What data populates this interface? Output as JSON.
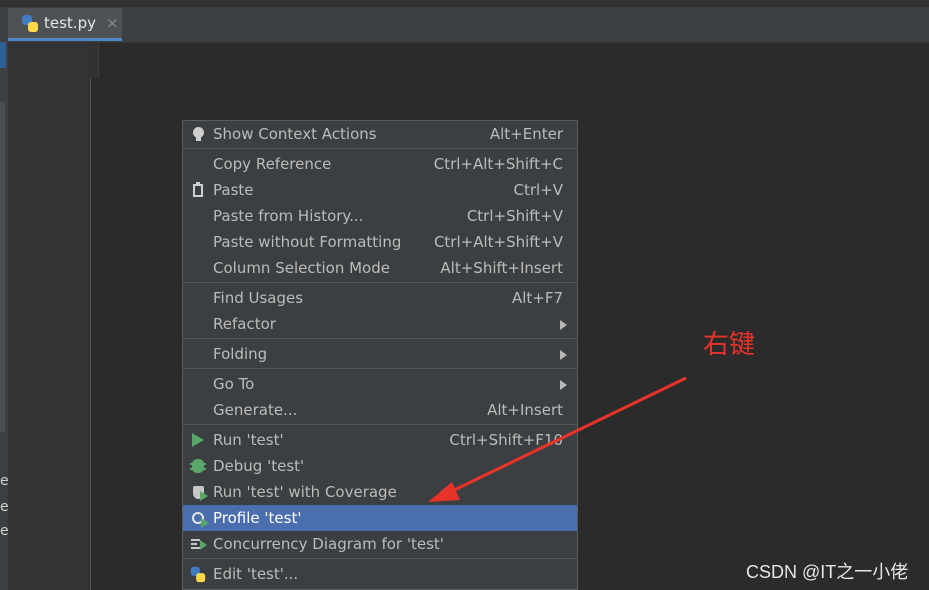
{
  "editor": {
    "tab": {
      "filename": "test.py",
      "close_glyph": "×",
      "icon": "python-file-icon"
    },
    "left_cut_chars": [
      "e",
      "e",
      "e"
    ]
  },
  "context_menu": {
    "items": [
      {
        "label": "Show Context Actions",
        "shortcut": "Alt+Enter",
        "icon": "lightbulb-icon"
      },
      {
        "label": "Copy Reference",
        "shortcut": "Ctrl+Alt+Shift+C"
      },
      {
        "label": "Paste",
        "shortcut": "Ctrl+V",
        "icon": "clipboard-icon"
      },
      {
        "label": "Paste from History...",
        "shortcut": "Ctrl+Shift+V"
      },
      {
        "label": "Paste without Formatting",
        "shortcut": "Ctrl+Alt+Shift+V"
      },
      {
        "label": "Column Selection Mode",
        "shortcut": "Alt+Shift+Insert"
      },
      {
        "label": "Find Usages",
        "shortcut": "Alt+F7"
      },
      {
        "label": "Refactor",
        "submenu": true
      },
      {
        "label": "Folding",
        "submenu": true
      },
      {
        "label": "Go To",
        "submenu": true
      },
      {
        "label": "Generate...",
        "shortcut": "Alt+Insert"
      },
      {
        "label": "Run 'test'",
        "shortcut": "Ctrl+Shift+F10",
        "icon": "run-icon"
      },
      {
        "label": "Debug 'test'",
        "icon": "debug-icon"
      },
      {
        "label": "Run 'test' with Coverage",
        "icon": "coverage-icon"
      },
      {
        "label": "Profile 'test'",
        "icon": "profile-icon",
        "selected": true
      },
      {
        "label": "Concurrency Diagram for 'test'",
        "icon": "concurrency-icon"
      },
      {
        "label": "Edit 'test'...",
        "icon": "python-icon"
      }
    ]
  },
  "annotation": {
    "text": "右键",
    "color": "#e8332a"
  },
  "watermark": "CSDN @IT之一小佬",
  "colors": {
    "selection": "#4b6eaf",
    "menu_bg": "#3c3f41",
    "editor_bg": "#2b2b2b"
  }
}
